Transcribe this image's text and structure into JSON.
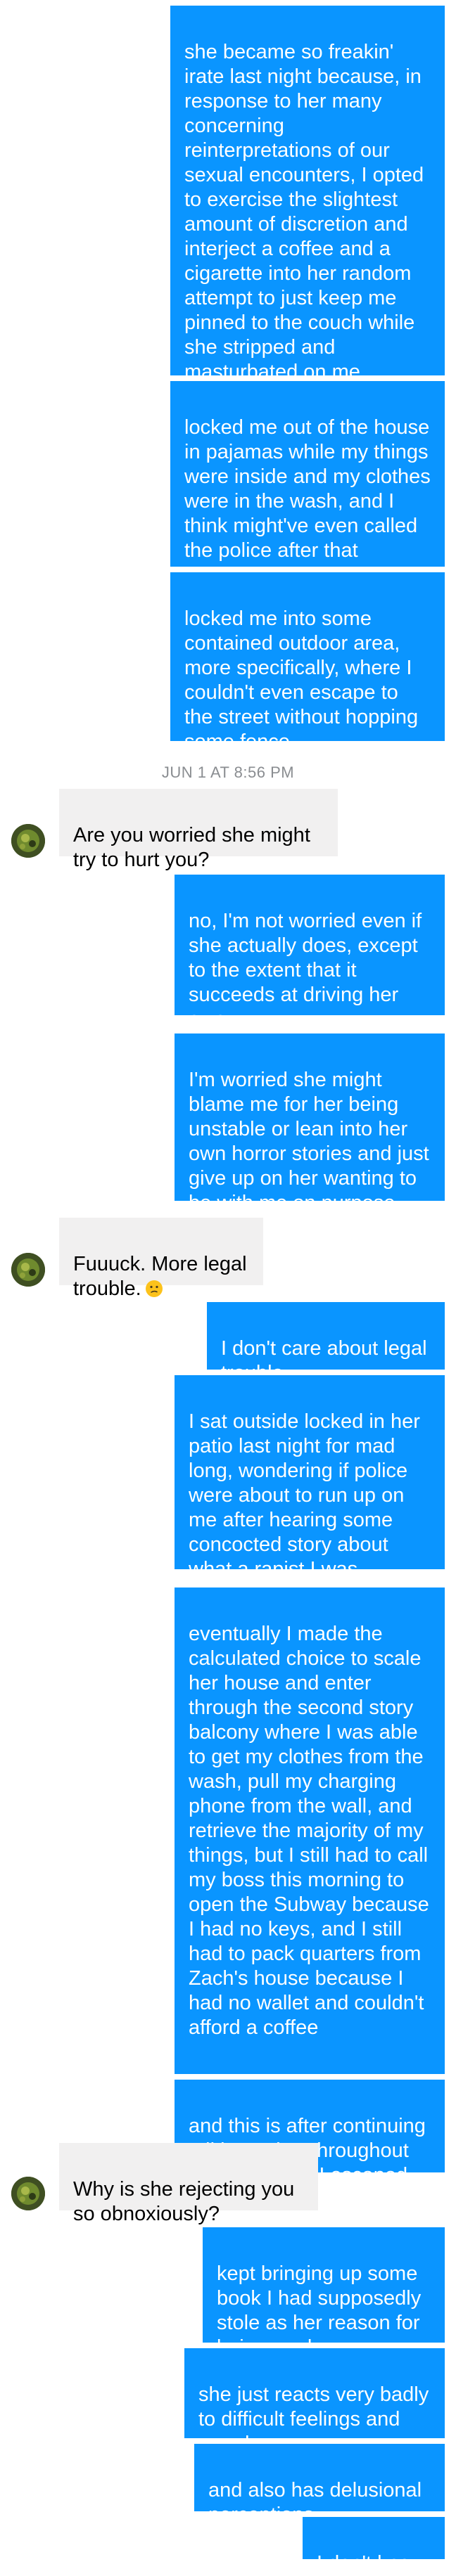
{
  "messages": [
    {
      "side": "out",
      "text": "she became so freakin' irate last night because, in response to her many concerning reinterpretations of our sexual encounters, I opted to exercise the slightest amount of discretion and interject a coffee and a cigarette into her random attempt to just keep me pinned to the couch while she stripped and masturbated on me"
    },
    {
      "side": "out",
      "text": "locked me out of the house in pajamas while my things were inside and my clothes were in the wash, and I think might've even called the police after that"
    },
    {
      "side": "out",
      "text": "locked me into some contained outdoor area, more specifically, where I couldn't even escape to the street without hopping some fence"
    },
    {
      "side": "in",
      "text": "Are you worried she might try to hurt you?"
    },
    {
      "side": "out",
      "text": "no, I'm not worried even if she actually does, except to the extent that it succeeds at driving her away"
    },
    {
      "side": "out",
      "text": "I'm worried she might blame me for her being unstable or lean into her own horror stories and just give up on her wanting to be with me on purpose"
    },
    {
      "side": "in",
      "text": "Fuuuck. More legal trouble.",
      "emoji": "confused-face-emoji"
    },
    {
      "side": "out",
      "text": "I don't care about legal trouble"
    },
    {
      "side": "out",
      "text": "I sat outside locked in her patio last night for mad long, wondering if police were about to run up on me after hearing some concocted story about what a rapist I was"
    },
    {
      "side": "out",
      "text": "eventually I made the calculated choice to scale her house and enter through the second story balcony where I was able to get my clothes from the wash, pull my charging phone from the wall, and retrieve the majority of my things, but I still had to call my boss this morning to open the Subway because I had no keys, and I still had to pack quarters from Zach's house because I had no wallet and couldn't afford a coffee"
    },
    {
      "side": "out",
      "text": "and this is after continuing talking to her throughout the night after I escaped"
    },
    {
      "side": "in",
      "text": "Why is she rejecting you so obnoxiously?"
    },
    {
      "side": "out",
      "text": "kept bringing up some book I had supposedly stole as her reason for being mad"
    },
    {
      "side": "out",
      "text": "she just reacts very badly to difficult feelings and moods"
    },
    {
      "side": "out",
      "text": "and also has delusional perceptions"
    },
    {
      "side": "out",
      "text": "I don't know"
    }
  ],
  "timestamp": "JUN 1 AT 8:56 PM",
  "colors": {
    "outgoing_bubble": "#0a95ff",
    "incoming_bubble": "#f1f0f0",
    "timestamp_text": "#8a8d91"
  },
  "icons": {
    "avatar": "contact-avatar",
    "emoji": "confused-face-emoji"
  }
}
